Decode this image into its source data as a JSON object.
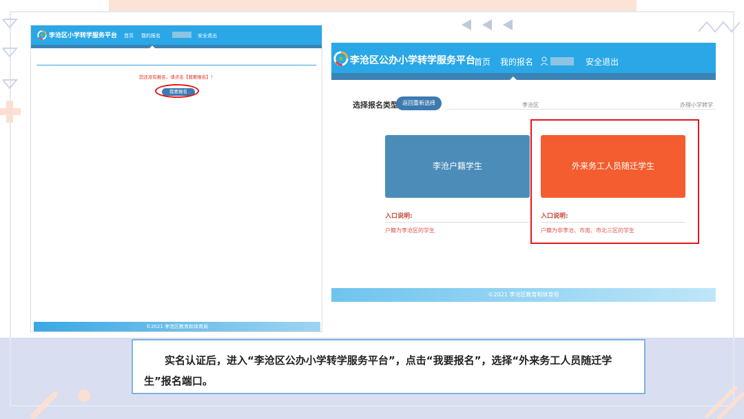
{
  "left_screenshot": {
    "header": {
      "title": "李沧区小学转学服务平台",
      "nav": [
        "首页",
        "我的报名"
      ],
      "logout": "安全退出"
    },
    "notice": "您还没有报名，请点击【我要报名】！",
    "apply_button": "我要报名",
    "footer": "©2021 李沧区教育和体育局"
  },
  "right_screenshot": {
    "header": {
      "title": "李沧区公办小学转学服务平台",
      "nav": [
        "首页",
        "我的报名"
      ],
      "logout": "安全退出"
    },
    "select_label": "选择报名类型",
    "reselect_button": "返回重新选择",
    "district": "李沧区",
    "service_type": "办理小学转学",
    "cards": [
      {
        "label": "李沧户籍学生",
        "entry_title": "入口说明:",
        "entry_desc": "户籍为李沧区的学生",
        "color": "#4b8db8"
      },
      {
        "label": "外来务工人员随迁学生",
        "entry_title": "入口说明:",
        "entry_desc": "户籍为非李沧、市南、市北三区的学生",
        "color": "#f35d2f"
      }
    ],
    "footer": "©2021 李沧区教育和体育局"
  },
  "caption": "实名认证后，进入“李沧区公办小学转学服务平台”，点击“我要报名”，选择“外来务工人员随迁学生”报名端口。",
  "colors": {
    "header_blue": "#2aa7e6",
    "band_blue": "#3c83b5",
    "highlight_red": "#e3161a"
  },
  "icons": [
    "platform-logo-icon",
    "user-icon",
    "left-arrow-icon",
    "triangle-icon",
    "zigzag-icon",
    "plus-icon"
  ]
}
